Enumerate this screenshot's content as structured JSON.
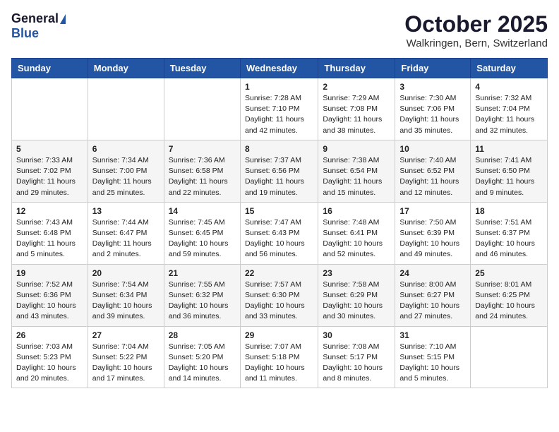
{
  "header": {
    "logo_general": "General",
    "logo_blue": "Blue",
    "month_title": "October 2025",
    "location": "Walkringen, Bern, Switzerland"
  },
  "calendar": {
    "days_of_week": [
      "Sunday",
      "Monday",
      "Tuesday",
      "Wednesday",
      "Thursday",
      "Friday",
      "Saturday"
    ],
    "weeks": [
      [
        {
          "day": "",
          "info": ""
        },
        {
          "day": "",
          "info": ""
        },
        {
          "day": "",
          "info": ""
        },
        {
          "day": "1",
          "info": "Sunrise: 7:28 AM\nSunset: 7:10 PM\nDaylight: 11 hours\nand 42 minutes."
        },
        {
          "day": "2",
          "info": "Sunrise: 7:29 AM\nSunset: 7:08 PM\nDaylight: 11 hours\nand 38 minutes."
        },
        {
          "day": "3",
          "info": "Sunrise: 7:30 AM\nSunset: 7:06 PM\nDaylight: 11 hours\nand 35 minutes."
        },
        {
          "day": "4",
          "info": "Sunrise: 7:32 AM\nSunset: 7:04 PM\nDaylight: 11 hours\nand 32 minutes."
        }
      ],
      [
        {
          "day": "5",
          "info": "Sunrise: 7:33 AM\nSunset: 7:02 PM\nDaylight: 11 hours\nand 29 minutes."
        },
        {
          "day": "6",
          "info": "Sunrise: 7:34 AM\nSunset: 7:00 PM\nDaylight: 11 hours\nand 25 minutes."
        },
        {
          "day": "7",
          "info": "Sunrise: 7:36 AM\nSunset: 6:58 PM\nDaylight: 11 hours\nand 22 minutes."
        },
        {
          "day": "8",
          "info": "Sunrise: 7:37 AM\nSunset: 6:56 PM\nDaylight: 11 hours\nand 19 minutes."
        },
        {
          "day": "9",
          "info": "Sunrise: 7:38 AM\nSunset: 6:54 PM\nDaylight: 11 hours\nand 15 minutes."
        },
        {
          "day": "10",
          "info": "Sunrise: 7:40 AM\nSunset: 6:52 PM\nDaylight: 11 hours\nand 12 minutes."
        },
        {
          "day": "11",
          "info": "Sunrise: 7:41 AM\nSunset: 6:50 PM\nDaylight: 11 hours\nand 9 minutes."
        }
      ],
      [
        {
          "day": "12",
          "info": "Sunrise: 7:43 AM\nSunset: 6:48 PM\nDaylight: 11 hours\nand 5 minutes."
        },
        {
          "day": "13",
          "info": "Sunrise: 7:44 AM\nSunset: 6:47 PM\nDaylight: 11 hours\nand 2 minutes."
        },
        {
          "day": "14",
          "info": "Sunrise: 7:45 AM\nSunset: 6:45 PM\nDaylight: 10 hours\nand 59 minutes."
        },
        {
          "day": "15",
          "info": "Sunrise: 7:47 AM\nSunset: 6:43 PM\nDaylight: 10 hours\nand 56 minutes."
        },
        {
          "day": "16",
          "info": "Sunrise: 7:48 AM\nSunset: 6:41 PM\nDaylight: 10 hours\nand 52 minutes."
        },
        {
          "day": "17",
          "info": "Sunrise: 7:50 AM\nSunset: 6:39 PM\nDaylight: 10 hours\nand 49 minutes."
        },
        {
          "day": "18",
          "info": "Sunrise: 7:51 AM\nSunset: 6:37 PM\nDaylight: 10 hours\nand 46 minutes."
        }
      ],
      [
        {
          "day": "19",
          "info": "Sunrise: 7:52 AM\nSunset: 6:36 PM\nDaylight: 10 hours\nand 43 minutes."
        },
        {
          "day": "20",
          "info": "Sunrise: 7:54 AM\nSunset: 6:34 PM\nDaylight: 10 hours\nand 39 minutes."
        },
        {
          "day": "21",
          "info": "Sunrise: 7:55 AM\nSunset: 6:32 PM\nDaylight: 10 hours\nand 36 minutes."
        },
        {
          "day": "22",
          "info": "Sunrise: 7:57 AM\nSunset: 6:30 PM\nDaylight: 10 hours\nand 33 minutes."
        },
        {
          "day": "23",
          "info": "Sunrise: 7:58 AM\nSunset: 6:29 PM\nDaylight: 10 hours\nand 30 minutes."
        },
        {
          "day": "24",
          "info": "Sunrise: 8:00 AM\nSunset: 6:27 PM\nDaylight: 10 hours\nand 27 minutes."
        },
        {
          "day": "25",
          "info": "Sunrise: 8:01 AM\nSunset: 6:25 PM\nDaylight: 10 hours\nand 24 minutes."
        }
      ],
      [
        {
          "day": "26",
          "info": "Sunrise: 7:03 AM\nSunset: 5:23 PM\nDaylight: 10 hours\nand 20 minutes."
        },
        {
          "day": "27",
          "info": "Sunrise: 7:04 AM\nSunset: 5:22 PM\nDaylight: 10 hours\nand 17 minutes."
        },
        {
          "day": "28",
          "info": "Sunrise: 7:05 AM\nSunset: 5:20 PM\nDaylight: 10 hours\nand 14 minutes."
        },
        {
          "day": "29",
          "info": "Sunrise: 7:07 AM\nSunset: 5:18 PM\nDaylight: 10 hours\nand 11 minutes."
        },
        {
          "day": "30",
          "info": "Sunrise: 7:08 AM\nSunset: 5:17 PM\nDaylight: 10 hours\nand 8 minutes."
        },
        {
          "day": "31",
          "info": "Sunrise: 7:10 AM\nSunset: 5:15 PM\nDaylight: 10 hours\nand 5 minutes."
        },
        {
          "day": "",
          "info": ""
        }
      ]
    ]
  }
}
